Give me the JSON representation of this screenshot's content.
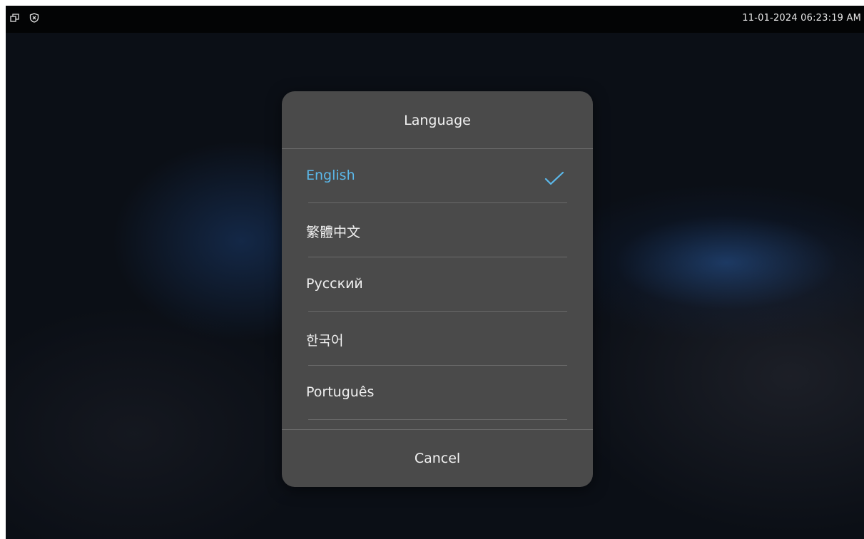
{
  "status_bar": {
    "icons": [
      "window-restore-icon",
      "shield-x-icon"
    ],
    "datetime": "11-01-2024 06:23:19 AM"
  },
  "dialog": {
    "title": "Language",
    "options": [
      {
        "label": "English",
        "selected": true
      },
      {
        "label": "繁體中文",
        "selected": false
      },
      {
        "label": "Русский",
        "selected": false
      },
      {
        "label": "한국어",
        "selected": false
      },
      {
        "label": "Português",
        "selected": false
      }
    ],
    "cancel_label": "Cancel",
    "accent_color": "#5bb8ea"
  }
}
